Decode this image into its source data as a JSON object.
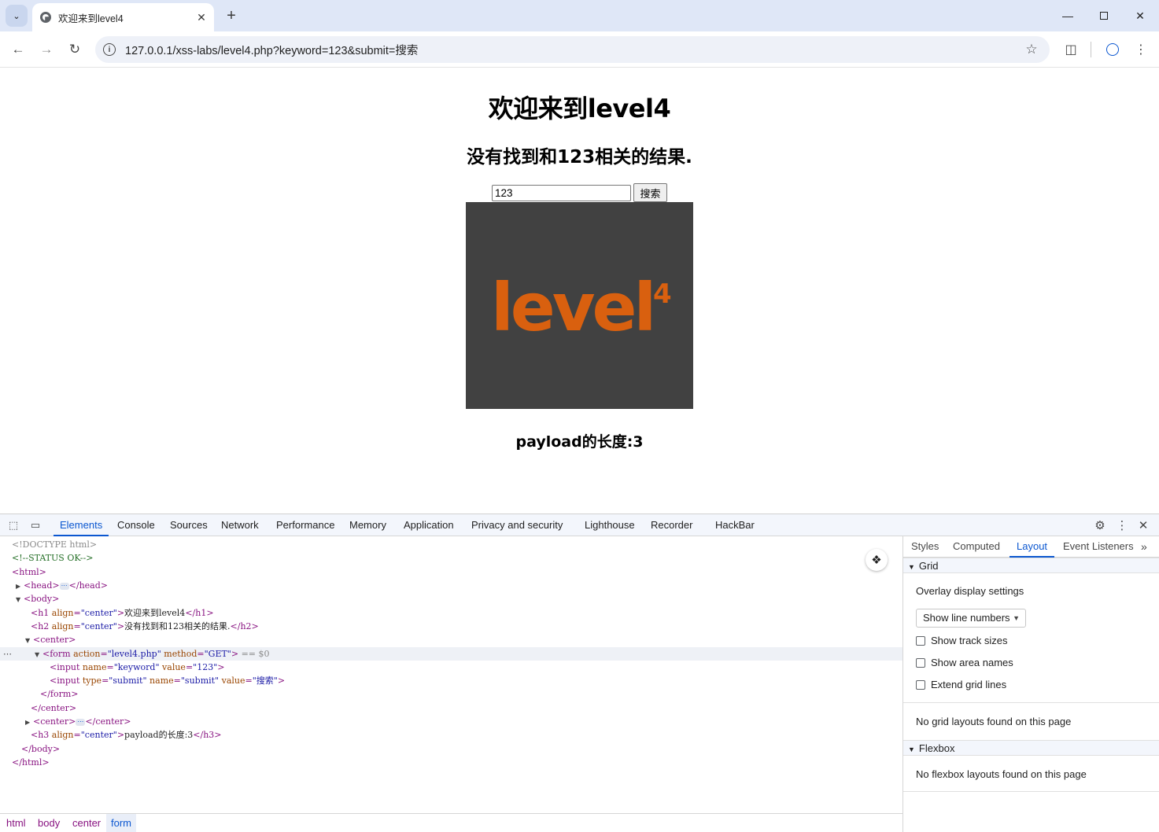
{
  "browser": {
    "tab_title": "欢迎来到level4",
    "url": "127.0.0.1/xss-labs/level4.php?keyword=123&submit=搜索"
  },
  "page": {
    "h1": "欢迎来到level4",
    "h2": "没有找到和123相关的结果.",
    "search_value": "123",
    "search_button": "搜索",
    "logo_text": "level",
    "logo_superscript": "4",
    "h3": "payload的长度:3"
  },
  "devtools": {
    "tabs": [
      "Elements",
      "Console",
      "Sources",
      "Network",
      "Performance",
      "Memory",
      "Application",
      "Privacy and security",
      "Lighthouse",
      "Recorder",
      "HackBar"
    ],
    "active_tab": "Elements",
    "dom": {
      "doctype": "<!DOCTYPE html>",
      "comment": "<!--STATUS OK-->",
      "html_open": "<html>",
      "head_open": "<head>",
      "head_close": "</head>",
      "body_open": "<body>",
      "h1_text": "欢迎来到level4",
      "h2_text": "没有找到和123相关的结果.",
      "center_open": "<center>",
      "form_action": "\"level4.php\"",
      "form_method": "\"GET\"",
      "selected_marker": "== $0",
      "input1_name": "\"keyword\"",
      "input1_value": "\"123\"",
      "input2_type": "\"submit\"",
      "input2_name": "\"submit\"",
      "input2_value": "\"搜索\"",
      "form_close": "</form>",
      "center_close": "</center>",
      "h3_text": "payload的长度:3",
      "body_close": "</body>",
      "html_close": "</html>"
    },
    "breadcrumbs": [
      "html",
      "body",
      "center",
      "form"
    ],
    "side_tabs": [
      "Styles",
      "Computed",
      "Layout",
      "Event Listeners"
    ],
    "side_active": "Layout",
    "layout": {
      "grid_header": "Grid",
      "overlay_settings": "Overlay display settings",
      "dropdown_value": "Show line numbers",
      "checkboxes": [
        "Show track sizes",
        "Show area names",
        "Extend grid lines"
      ],
      "no_grid": "No grid layouts found on this page",
      "flexbox_header": "Flexbox",
      "no_flexbox": "No flexbox layouts found on this page"
    }
  },
  "colors": {
    "logo_bg": "#414141",
    "logo_orange": "#d9600f",
    "accent": "#0b57d0"
  }
}
